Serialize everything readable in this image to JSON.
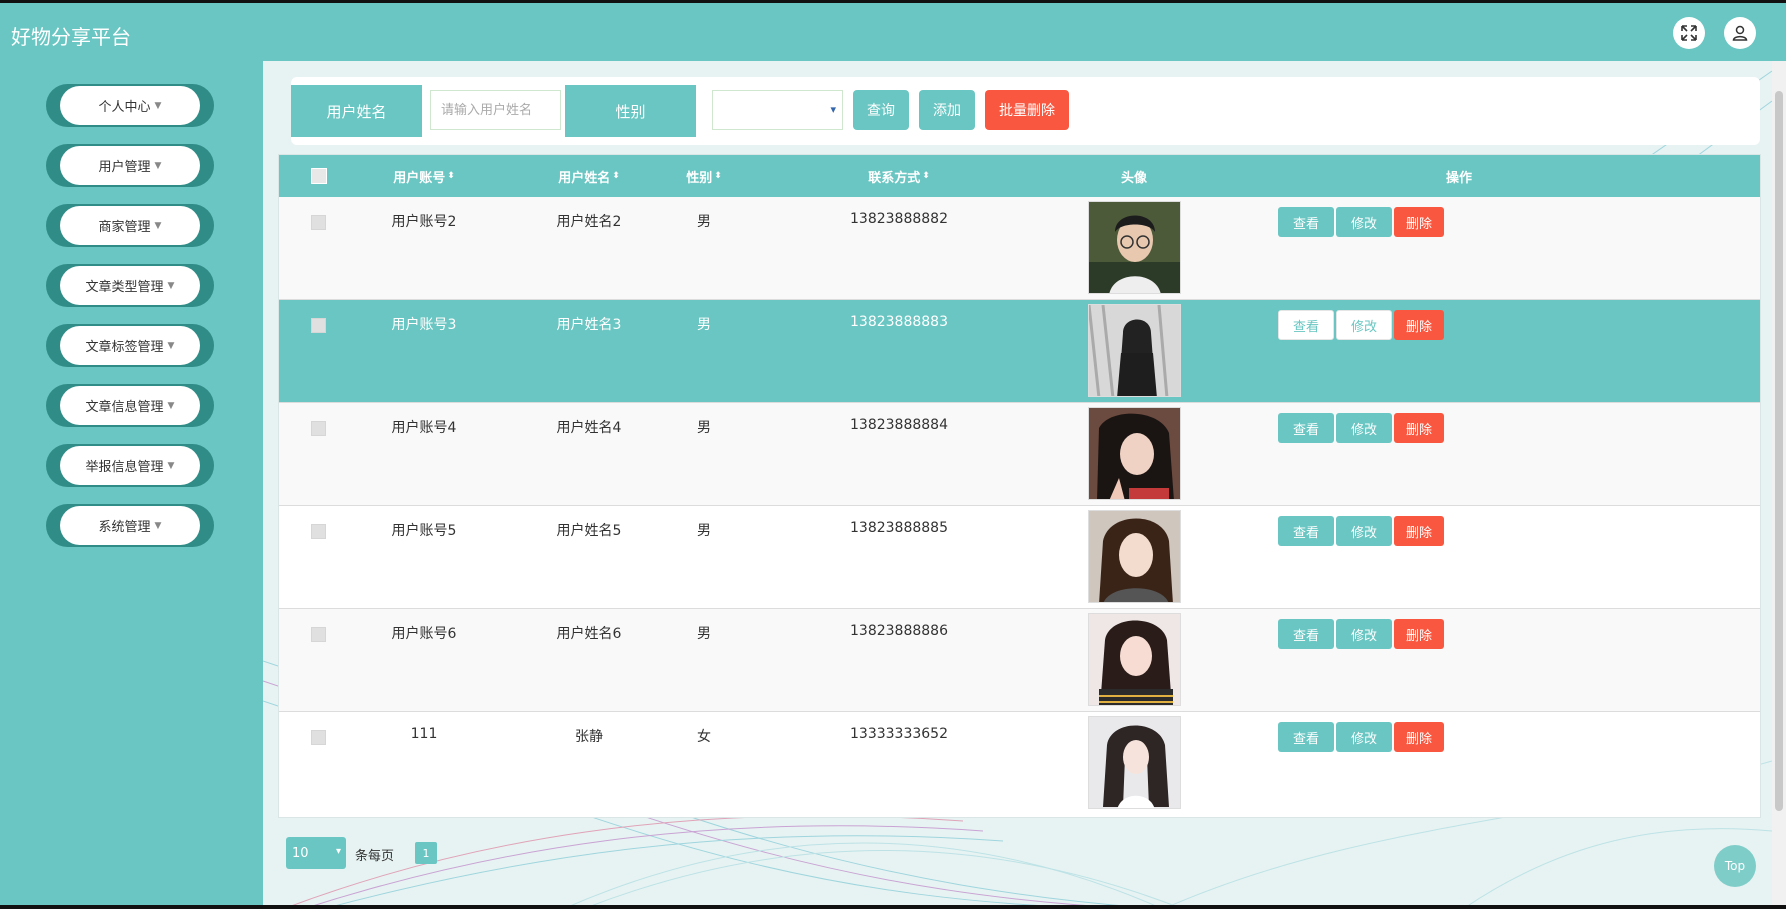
{
  "app": {
    "title": "好物分享平台"
  },
  "header_icons": {
    "fullscreen": "fullscreen-icon",
    "user": "user-icon"
  },
  "sidebar": {
    "items": [
      {
        "label": "个人中心"
      },
      {
        "label": "用户管理"
      },
      {
        "label": "商家管理"
      },
      {
        "label": "文章类型管理"
      },
      {
        "label": "文章标签管理"
      },
      {
        "label": "文章信息管理"
      },
      {
        "label": "举报信息管理"
      },
      {
        "label": "系统管理"
      }
    ]
  },
  "search": {
    "name_label": "用户姓名",
    "name_placeholder": "请输入用户姓名",
    "gender_label": "性别",
    "gender_value": "",
    "query_button": "查询",
    "add_button": "添加",
    "batch_delete_button": "批量删除"
  },
  "table": {
    "columns": [
      "用户账号",
      "用户姓名",
      "性别",
      "联系方式",
      "头像",
      "操作"
    ],
    "rows": [
      {
        "account": "用户账号2",
        "name": "用户姓名2",
        "gender": "男",
        "phone": "13823888882"
      },
      {
        "account": "用户账号3",
        "name": "用户姓名3",
        "gender": "男",
        "phone": "13823888883"
      },
      {
        "account": "用户账号4",
        "name": "用户姓名4",
        "gender": "男",
        "phone": "13823888884"
      },
      {
        "account": "用户账号5",
        "name": "用户姓名5",
        "gender": "男",
        "phone": "13823888885"
      },
      {
        "account": "用户账号6",
        "name": "用户姓名6",
        "gender": "男",
        "phone": "13823888886"
      },
      {
        "account": "111",
        "name": "张静",
        "gender": "女",
        "phone": "13333333652"
      }
    ],
    "actions": {
      "view": "查看",
      "edit": "修改",
      "delete": "删除"
    }
  },
  "pagination": {
    "page_size": "10",
    "per_page_label": "条每页",
    "current_page": "1"
  },
  "back_to_top": "Top",
  "colors": {
    "primary": "#69c6c2",
    "danger": "#f9573f",
    "sidebar_pill": "#2f8c87"
  }
}
